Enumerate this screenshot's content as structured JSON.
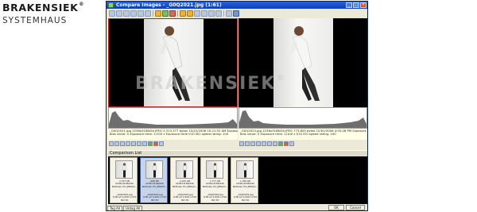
{
  "brand": {
    "name": "BRAKENSIEK",
    "reg": "®",
    "sub": "SYSTEMHAUS"
  },
  "window": {
    "title": "Compare Images - _G0Q2021.jpg (1:61)",
    "buttons": [
      "minimize",
      "maximize",
      "close"
    ]
  },
  "watermark": {
    "text": "BRAKENSIEK",
    "reg": "®"
  },
  "left": {
    "info_line1": "_G0Q2021.jpg  2236x3168/2b  JPEG  3,313,377 bytes  10/22/2006 10:21:52 AM  Exposure",
    "info_line2": "bias value: 0  Exposure time: 1/100 s  Exposure time  f/10  ISO speed rating: 100"
  },
  "right": {
    "info_line1": "_G0Q2023.jpg  2236x3168/2b  JPEG  773,805 bytes  12/01/2006 4:05:28 PM  Exposure",
    "info_line2": "bias value: 0  Exposure time: 1/100 s  f/10  ISO speed rating: 100"
  },
  "comparison_list": {
    "title": "Comparison List",
    "items": [
      {
        "size": "2,707 KB",
        "dims": "2236x3168/24b",
        "fmt": "NCDilian Pro JPEG/D...",
        "name": "_G0Q2021.jpg",
        "exp": "0.00 eV 1/100 s f/10",
        "iso": "ISO 50",
        "selected": false
      },
      {
        "size": "608 KB",
        "dims": "2236x3168/24b",
        "fmt": "NCDilian Pro JPEG/D...",
        "name": "_G0Q2022.jpg",
        "exp": "0.00 eV 1/100 s f/10",
        "iso": "ISO 50",
        "selected": true
      },
      {
        "size": "2,242 KB",
        "dims": "2236x3168/24b",
        "fmt": "NCDilian Pro JPEG/D...",
        "name": "_G0Q2023.jpg",
        "exp": "0.00 eV 1/100 s f/10",
        "iso": "ISO 50",
        "selected": false
      },
      {
        "size": "1,777 KB",
        "dims": "2236x3168/24b",
        "fmt": "NCDilian Pro JPEG/D...",
        "name": "_G0Q2024.jpg",
        "exp": "0.00 eV 1/100 s f/10",
        "iso": "ISO 50",
        "selected": false
      },
      {
        "size": "1,766 KB",
        "dims": "2236x3168/24b",
        "fmt": "NCDilian Pro JPEG/D...",
        "name": "_G0Q2025.jpg",
        "exp": "0.00 eV 1/100 s f/10",
        "iso": "ISO 50",
        "selected": false
      }
    ]
  },
  "status": {
    "tag_all": "Tag All",
    "untag_all": "Untag All",
    "ok": "OK",
    "cancel": "Cancel"
  }
}
